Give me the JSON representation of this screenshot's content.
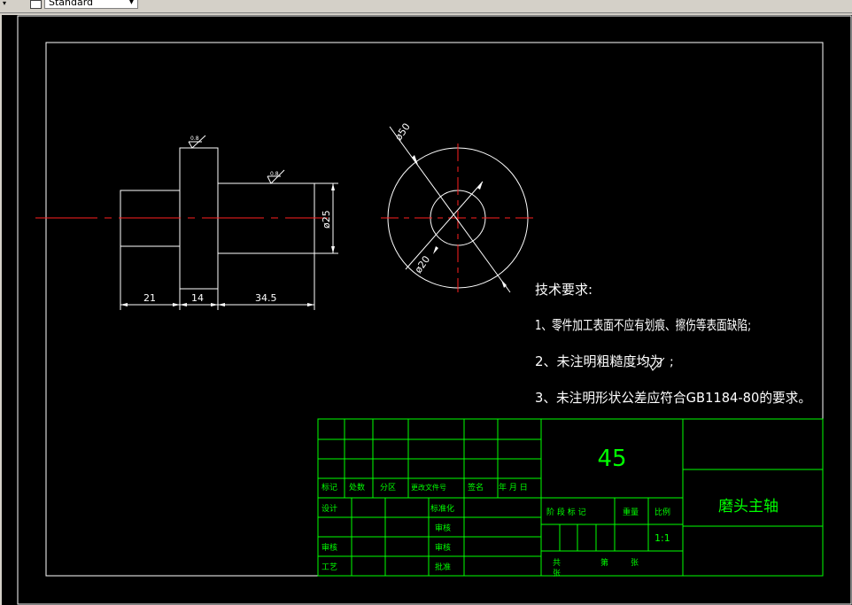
{
  "toolbar": {
    "style_combo_value": "Standard"
  },
  "drawing": {
    "dimensions": {
      "len1": "21",
      "len2": "14",
      "len3": "34.5",
      "dia_shaft": "ø25",
      "dia_outer": "ø50",
      "dia_inner": "ø20"
    },
    "roughness_symbols": [
      "0.8",
      "0.8"
    ],
    "tech_req": {
      "title": "技术要求:",
      "items": [
        "1、零件加工表面不应有划痕、擦伤等表面缺陷;",
        "2、未注明粗糙度均为",
        "3、未注明形状公差应符合GB1184-80的要求。"
      ],
      "roughness_inline": "6.3",
      "item2_suffix": ";"
    }
  },
  "title_block": {
    "material": "45",
    "part_name": "磨头主轴",
    "scale_label": "比例",
    "scale_value": "1:1",
    "weight_label": "重量",
    "stage_label": "阶 段 标 记",
    "rev_headers": [
      "标记",
      "处数",
      "分区",
      "更改文件号",
      "签名",
      "年 月 日"
    ],
    "design": "设计",
    "standardize": "标准化",
    "check_approve": "审核",
    "process": "工艺",
    "review": "审核",
    "tech_review": "审核",
    "approve": "批准",
    "total_sheets": "共",
    "sheets_label": "张",
    "sheet_no": "第",
    "zhang2": "张"
  },
  "colors": {
    "background": "#000000",
    "lines": "#ffffff",
    "center_line": "#ff2020",
    "title_block": "#00ff00"
  }
}
